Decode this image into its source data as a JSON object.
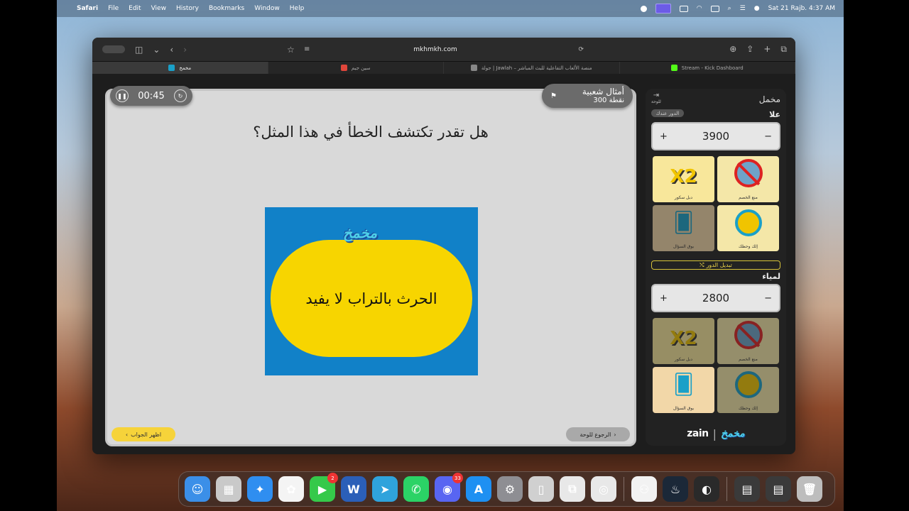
{
  "menubar": {
    "app_name": "Safari",
    "menus": [
      "File",
      "Edit",
      "View",
      "History",
      "Bookmarks",
      "Window",
      "Help"
    ],
    "datetime": "Sat 21 Rajb.  4:37 AM"
  },
  "browser": {
    "url": "mkhmkh.com",
    "tabs": [
      {
        "title": "مخمخ",
        "active": true,
        "fav_color": "#1aa0c8"
      },
      {
        "title": "سين جيم",
        "active": false,
        "fav_color": "#e0463b"
      },
      {
        "title": "جولة | Jawlah – منصة الألعاب التفاعلية للبث المباشر",
        "active": false,
        "fav_color": "#888888"
      },
      {
        "title": "Stream - Kick Dashboard",
        "active": false,
        "fav_color": "#53fc18"
      }
    ]
  },
  "game": {
    "timer": "00:45",
    "category": "أمثال شعبية",
    "points": "300 نقطة",
    "question": "هل تقدر تكتشف الخطأ في هذا المثل؟",
    "card_logo": "مخمخ",
    "proverb": "الحرث بالتراب لا يفيد",
    "show_answer_label": "اظهر الجواب",
    "back_to_board_label": "الرجوع للوحة"
  },
  "sidebar": {
    "exit_label": "للوحة",
    "team_title": "مخمل",
    "turn_badge": "الدور عندك",
    "switch_turn_label": "تبديل الدور",
    "teams": [
      {
        "name": "علا",
        "score": "3900",
        "aids": [
          {
            "type": "x2",
            "label": "دبل سكور",
            "used": false
          },
          {
            "type": "block",
            "label": "منع الخصم",
            "used": false
          },
          {
            "type": "cards",
            "label": "بوق السؤال",
            "used": true
          },
          {
            "type": "wheel",
            "label": "إلك وحظك",
            "used": false
          }
        ]
      },
      {
        "name": "لمياء",
        "score": "2800",
        "aids": [
          {
            "type": "x2",
            "label": "دبل سكور",
            "used": true
          },
          {
            "type": "block",
            "label": "منع الخصم",
            "used": true
          },
          {
            "type": "cards",
            "label": "بوق السؤال",
            "used": false
          },
          {
            "type": "wheel",
            "label": "إلك وحظك",
            "used": true
          }
        ]
      }
    ],
    "footer_brand": "zain",
    "footer_logo": "مخمخ"
  },
  "dock": {
    "apps": [
      {
        "name": "finder-icon",
        "color": "#3b8fe8",
        "glyph": "☺"
      },
      {
        "name": "launchpad-icon",
        "color": "#c9c9c9",
        "glyph": "▦"
      },
      {
        "name": "safari-icon",
        "color": "#2f8ef0",
        "glyph": "✦"
      },
      {
        "name": "photos-icon",
        "color": "#f4f4f4",
        "glyph": "✿"
      },
      {
        "name": "facetime-icon",
        "color": "#35c94a",
        "glyph": "▶",
        "badge": "2"
      },
      {
        "name": "word-icon",
        "color": "#2b5fb8",
        "glyph": "W"
      },
      {
        "name": "telegram-icon",
        "color": "#2fa3dc",
        "glyph": "➤"
      },
      {
        "name": "whatsapp-icon",
        "color": "#2bd366",
        "glyph": "✆"
      },
      {
        "name": "discord-icon",
        "color": "#5865f2",
        "glyph": "◉",
        "badge": "33"
      },
      {
        "name": "app-store-icon",
        "color": "#1e90f2",
        "glyph": "A"
      },
      {
        "name": "system-settings-icon",
        "color": "#8e8e93",
        "glyph": "⚙"
      },
      {
        "name": "iphone-mirroring-icon",
        "color": "#d0d0d0",
        "glyph": "▯"
      },
      {
        "name": "parallels-icon",
        "color": "#e8e8e8",
        "glyph": "⧉"
      },
      {
        "name": "chrome-icon",
        "color": "#e8e8e8",
        "glyph": "◎"
      },
      {
        "name": "automator-icon",
        "color": "#f2f2f2",
        "glyph": "⚇"
      },
      {
        "name": "steam-icon",
        "color": "#1b2838",
        "glyph": "♨"
      },
      {
        "name": "obs-icon",
        "color": "#2a2a2a",
        "glyph": "◐"
      },
      {
        "name": "stack-folder-icon",
        "color": "#3a3a3a",
        "glyph": "▤"
      },
      {
        "name": "stack-folder-2-icon",
        "color": "#3a3a3a",
        "glyph": "▤"
      },
      {
        "name": "trash-icon",
        "color": "#bdbdbd",
        "glyph": "🗑"
      }
    ]
  }
}
